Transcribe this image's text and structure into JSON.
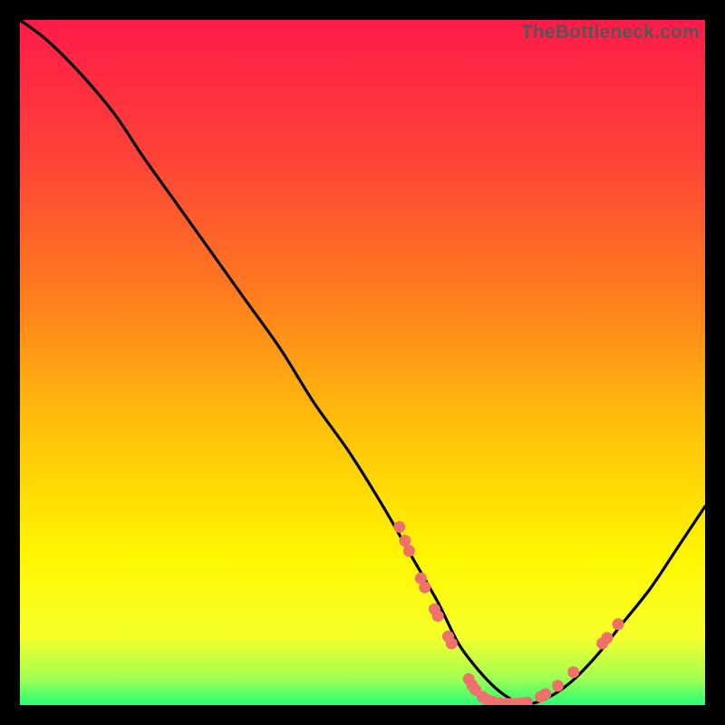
{
  "watermark": "TheBottleneck.com",
  "chart_data": {
    "type": "line",
    "title": "",
    "xlabel": "",
    "ylabel": "",
    "xlim": [
      0,
      100
    ],
    "ylim": [
      0,
      100
    ],
    "series": [
      {
        "name": "curve",
        "x": [
          0,
          4,
          9,
          14,
          18,
          23,
          28,
          33,
          38,
          43,
          48,
          53,
          57,
          61,
          64,
          67,
          70,
          73,
          76,
          80,
          84,
          88,
          92,
          96,
          100
        ],
        "y": [
          100,
          97,
          92,
          86,
          80,
          73,
          66,
          59,
          52,
          44,
          37,
          29,
          22,
          15,
          9,
          5,
          2,
          0.3,
          0.6,
          3,
          7,
          12,
          17,
          23,
          29
        ]
      }
    ],
    "markers": {
      "name": "highlight-points",
      "hex": "#ef716c",
      "points": [
        {
          "x": 55.4,
          "y": 26.0
        },
        {
          "x": 56.2,
          "y": 24.0
        },
        {
          "x": 56.8,
          "y": 22.5
        },
        {
          "x": 58.5,
          "y": 18.5
        },
        {
          "x": 59.1,
          "y": 17.2
        },
        {
          "x": 60.5,
          "y": 14.0
        },
        {
          "x": 61.0,
          "y": 13.0
        },
        {
          "x": 62.5,
          "y": 10.0
        },
        {
          "x": 63.0,
          "y": 9.0
        },
        {
          "x": 65.5,
          "y": 3.8
        },
        {
          "x": 66.0,
          "y": 2.9
        },
        {
          "x": 66.5,
          "y": 2.2
        },
        {
          "x": 67.5,
          "y": 1.2
        },
        {
          "x": 68.3,
          "y": 0.7
        },
        {
          "x": 69.0,
          "y": 0.5
        },
        {
          "x": 70.0,
          "y": 0.3
        },
        {
          "x": 71.0,
          "y": 0.2
        },
        {
          "x": 71.7,
          "y": 0.2
        },
        {
          "x": 72.5,
          "y": 0.2
        },
        {
          "x": 73.3,
          "y": 0.3
        },
        {
          "x": 74.0,
          "y": 0.4
        },
        {
          "x": 76.0,
          "y": 1.2
        },
        {
          "x": 76.7,
          "y": 1.6
        },
        {
          "x": 78.5,
          "y": 2.8
        },
        {
          "x": 80.8,
          "y": 4.8
        },
        {
          "x": 85.0,
          "y": 9.0
        },
        {
          "x": 85.7,
          "y": 9.8
        },
        {
          "x": 87.3,
          "y": 11.8
        }
      ]
    },
    "gradient_stops": [
      {
        "offset": 0,
        "hex": "#ff1b49"
      },
      {
        "offset": 20,
        "hex": "#ff4238"
      },
      {
        "offset": 40,
        "hex": "#ff7c1e"
      },
      {
        "offset": 60,
        "hex": "#ffc20a"
      },
      {
        "offset": 78,
        "hex": "#fff600"
      },
      {
        "offset": 90,
        "hex": "#f6ff2a"
      },
      {
        "offset": 96,
        "hex": "#a3ff52"
      },
      {
        "offset": 100,
        "hex": "#29ff74"
      }
    ]
  }
}
